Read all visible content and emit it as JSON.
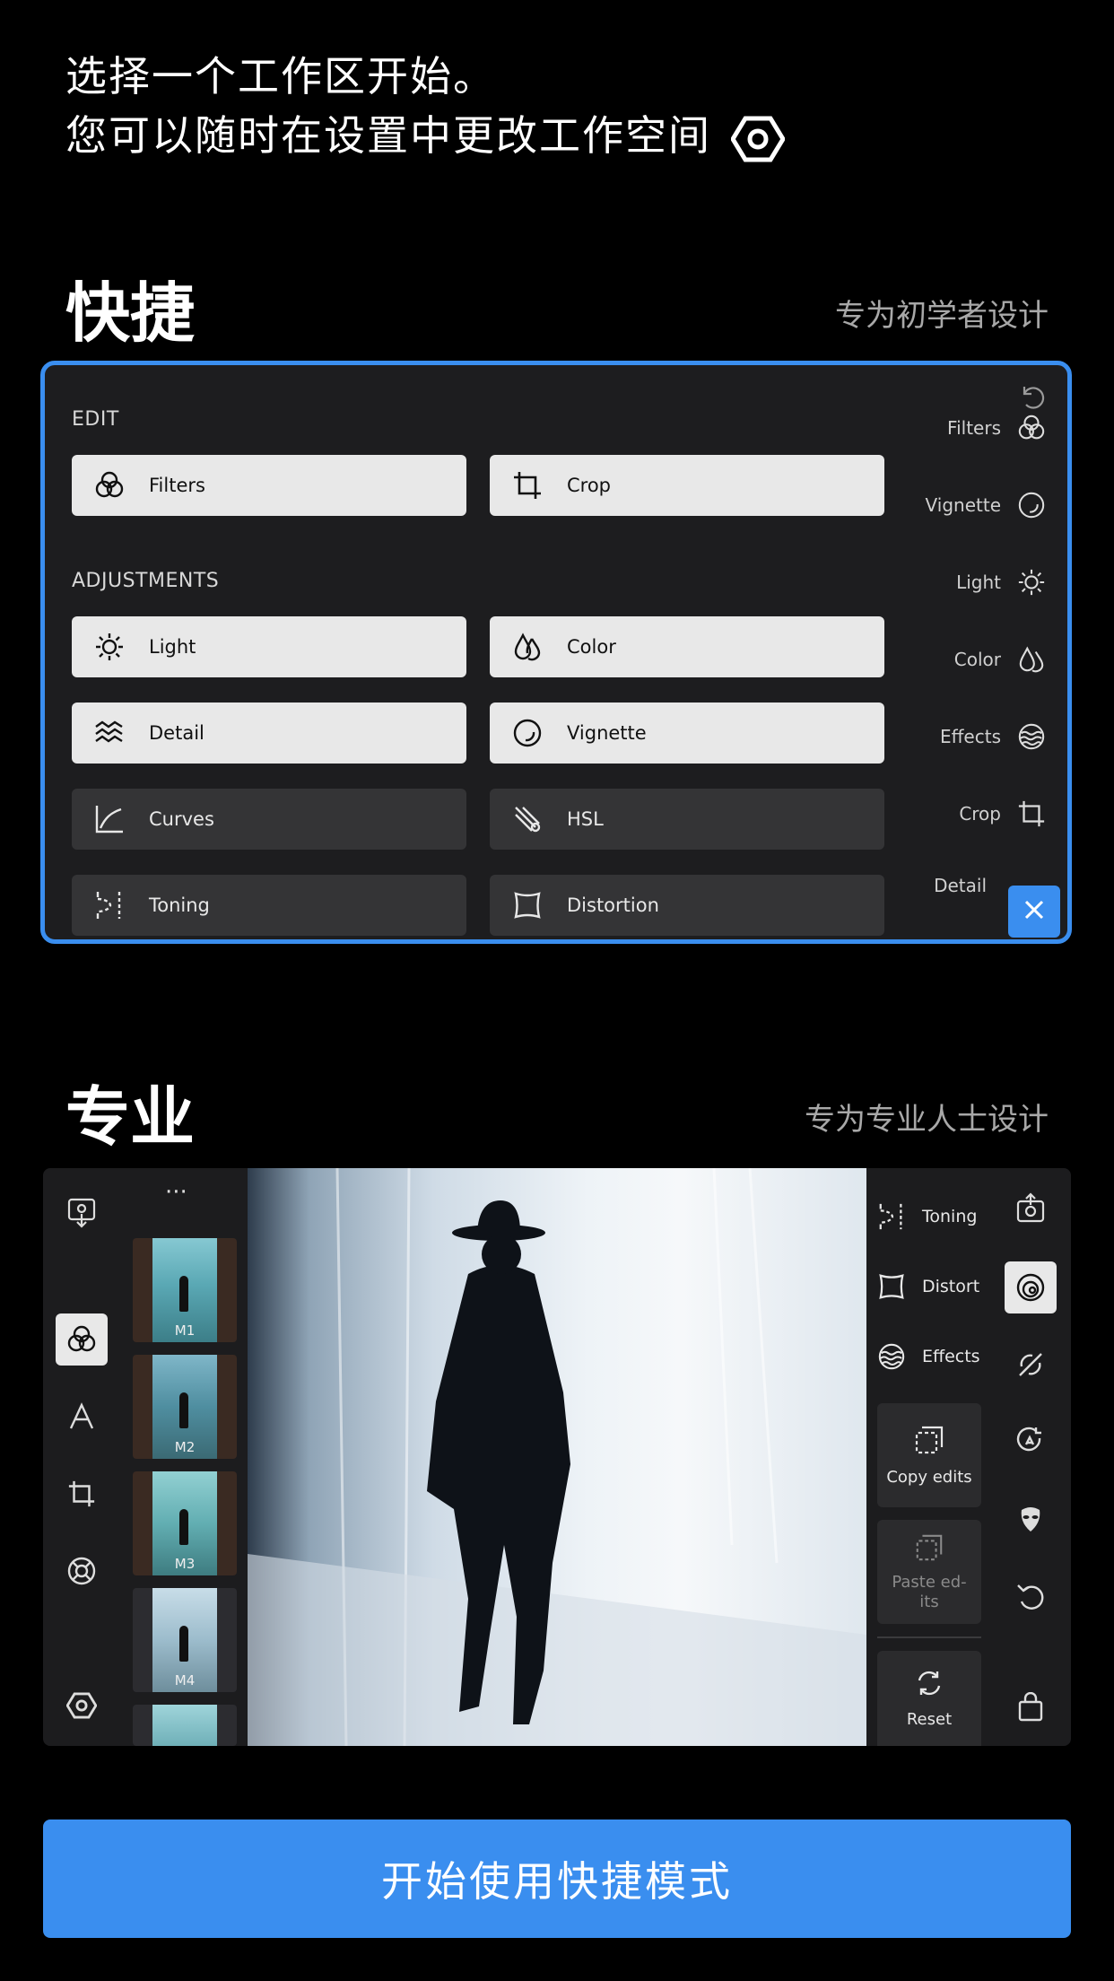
{
  "intro": {
    "line1": "选择一个工作区开始。",
    "line2": "您可以随时在设置中更改工作空间",
    "settings_icon": "gear-hex-icon"
  },
  "quick": {
    "title": "快捷",
    "subtitle": "专为初学者设计",
    "edit_label": "EDIT",
    "adjust_label": "ADJUSTMENTS",
    "edit_tools": [
      {
        "label": "Filters",
        "icon": "filters-icon"
      },
      {
        "label": "Crop",
        "icon": "crop-icon"
      }
    ],
    "adjust_tools": [
      {
        "label": "Light",
        "icon": "sun-icon"
      },
      {
        "label": "Color",
        "icon": "drops-icon"
      },
      {
        "label": "Detail",
        "icon": "waves-icon"
      },
      {
        "label": "Vignette",
        "icon": "vignette-icon"
      },
      {
        "label": "Curves",
        "icon": "curves-icon"
      },
      {
        "label": "HSL",
        "icon": "hsl-icon"
      },
      {
        "label": "Toning",
        "icon": "toning-icon"
      },
      {
        "label": "Distortion",
        "icon": "distortion-icon"
      }
    ],
    "rail": [
      "Filters",
      "Vignette",
      "Light",
      "Color",
      "Effects",
      "Crop",
      "Detail"
    ],
    "close_icon": "close-icon",
    "accent": "#3a8eef"
  },
  "pro": {
    "title": "专业",
    "subtitle": "专为专业人士设计",
    "more": "···",
    "thumbs": [
      "M1",
      "M2",
      "M3",
      "M4"
    ],
    "right_tools": [
      "Toning",
      "Distort",
      "Effects"
    ],
    "copy_edits": "Copy edits",
    "paste_edits": "Paste ed-\nits",
    "reset": "Reset"
  },
  "cta": {
    "label": "开始使用快捷模式",
    "color": "#3a8eef"
  }
}
